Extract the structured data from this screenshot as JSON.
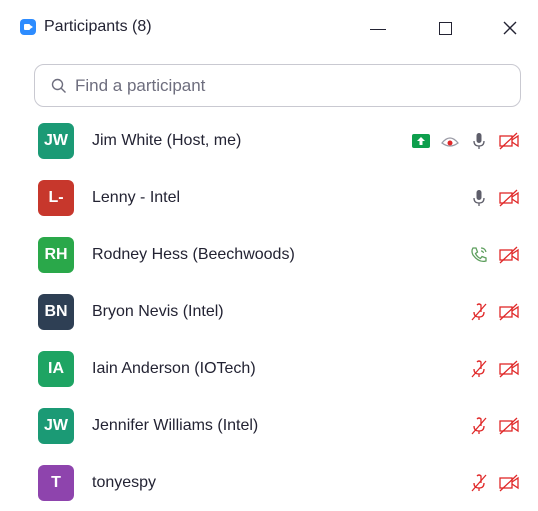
{
  "window": {
    "title": "Participants (8)"
  },
  "search": {
    "placeholder": "Find a participant"
  },
  "colors": {
    "accent": "#2D8CFF",
    "muted_red": "#E02828",
    "share_green": "#0E9F4D"
  },
  "participants": [
    {
      "initials": "JW",
      "name": "Jim White (Host, me)",
      "avatar_color": "#1B9A75",
      "icons": [
        "share-screen-icon",
        "record-icon",
        "microphone-icon",
        "video-off-icon"
      ]
    },
    {
      "initials": "L-",
      "name": "Lenny - Intel",
      "avatar_color": "#C7372C",
      "icons": [
        "microphone-icon",
        "video-off-icon"
      ]
    },
    {
      "initials": "RH",
      "name": "Rodney Hess (Beechwoods)",
      "avatar_color": "#2AA84A",
      "icons": [
        "phone-icon",
        "video-off-icon"
      ]
    },
    {
      "initials": "BN",
      "name": "Bryon Nevis (Intel)",
      "avatar_color": "#2E3F54",
      "icons": [
        "microphone-muted-icon",
        "video-off-icon"
      ]
    },
    {
      "initials": "IA",
      "name": "Iain Anderson (IOTech)",
      "avatar_color": "#1EA463",
      "icons": [
        "microphone-muted-icon",
        "video-off-icon"
      ]
    },
    {
      "initials": "JW",
      "name": "Jennifer Williams (Intel)",
      "avatar_color": "#1B9A75",
      "icons": [
        "microphone-muted-icon",
        "video-off-icon"
      ]
    },
    {
      "initials": "T",
      "name": "tonyespy",
      "avatar_color": "#8E44AD",
      "icons": [
        "microphone-muted-icon",
        "video-off-icon"
      ]
    }
  ]
}
